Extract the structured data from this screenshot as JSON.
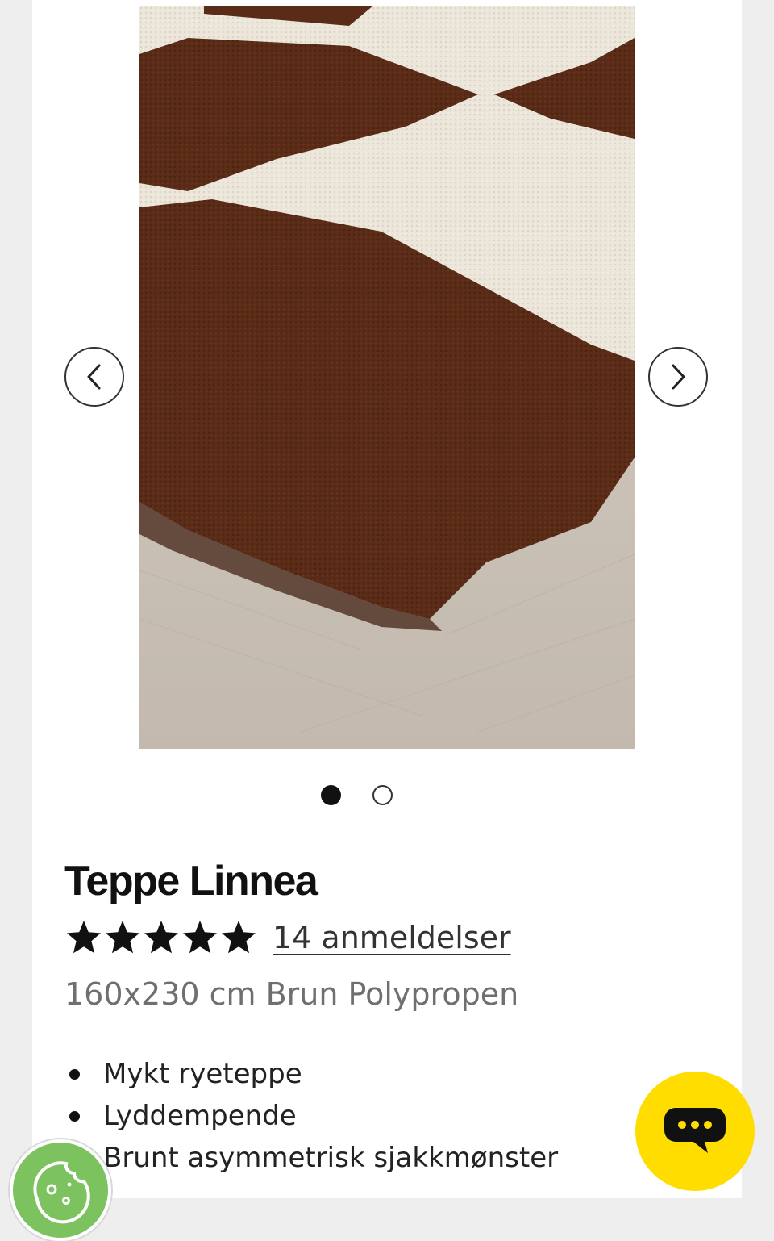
{
  "product": {
    "title": "Teppe Linnea",
    "rating": 5,
    "rating_max": 5,
    "reviews_label": "14 anmeldelser",
    "subtitle": "160x230 cm Brun Polypropen",
    "features": [
      "Mykt ryeteppe",
      "Lyddempende",
      "Brunt asymmetrisk sjakkmønster"
    ]
  },
  "carousel": {
    "slide_count": 2,
    "active_slide": 1
  },
  "colors": {
    "rug_brown": "#5a2c17",
    "rug_cream": "#ece6da",
    "floor": "#cbc2b8",
    "chat_button": "#ffdd00",
    "cookie_button": "#7cc25e",
    "stars": "#111111"
  },
  "icons": {
    "prev": "chevron-left-icon",
    "next": "chevron-right-icon",
    "chat": "chat-bubble-icon",
    "cookie": "cookie-icon",
    "star": "star-icon"
  }
}
